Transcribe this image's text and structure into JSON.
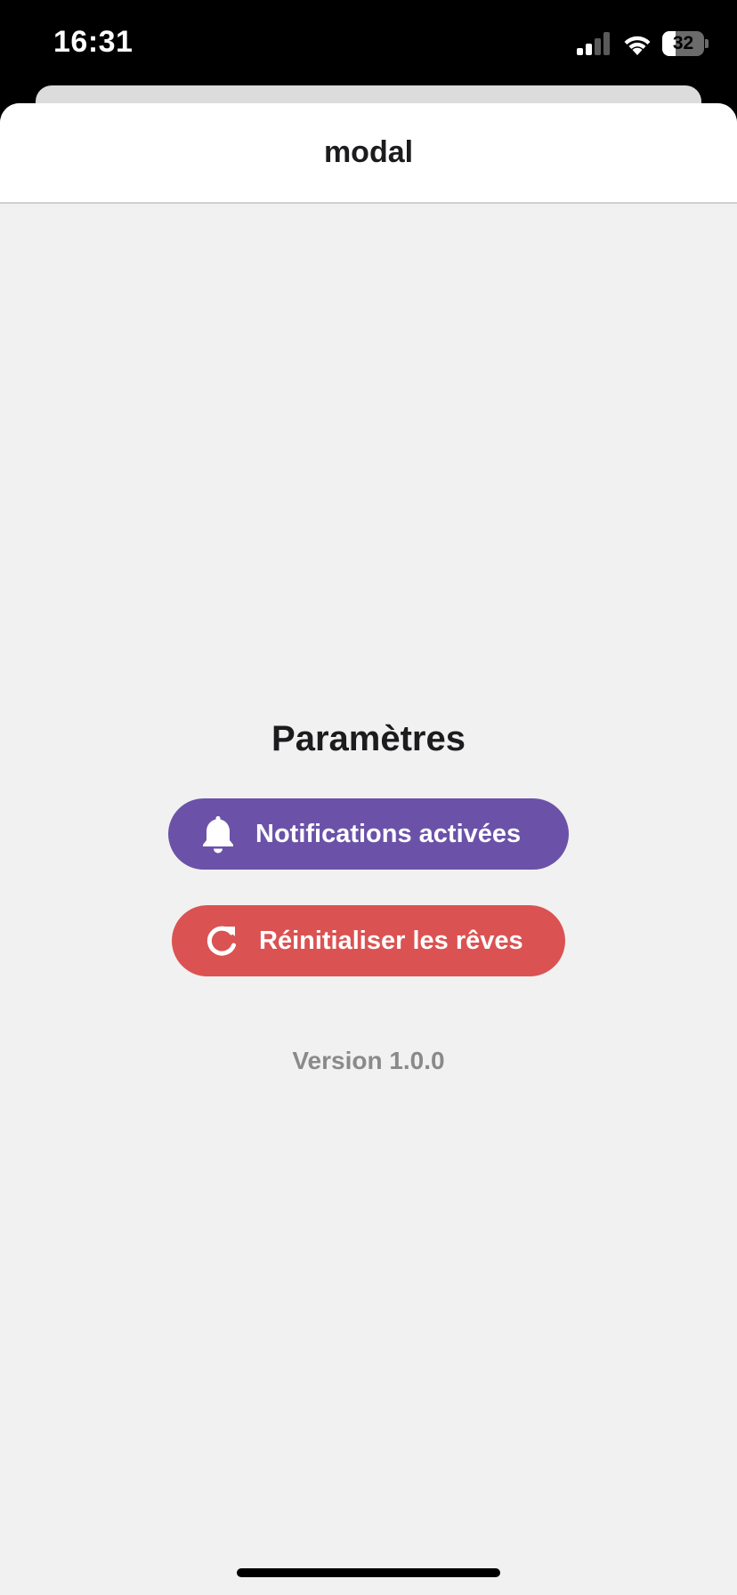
{
  "status_bar": {
    "time": "16:31",
    "battery_level": "32",
    "icons": [
      "signal-icon",
      "wifi-icon",
      "battery-icon"
    ]
  },
  "modal": {
    "title": "modal"
  },
  "settings": {
    "title": "Paramètres",
    "notifications_button": {
      "label": "Notifications activées",
      "icon": "bell-icon",
      "color": "#6b52a8"
    },
    "reset_button": {
      "label": "Réinitialiser les rêves",
      "icon": "refresh-icon",
      "color": "#db5252"
    },
    "version": "Version 1.0.0"
  }
}
